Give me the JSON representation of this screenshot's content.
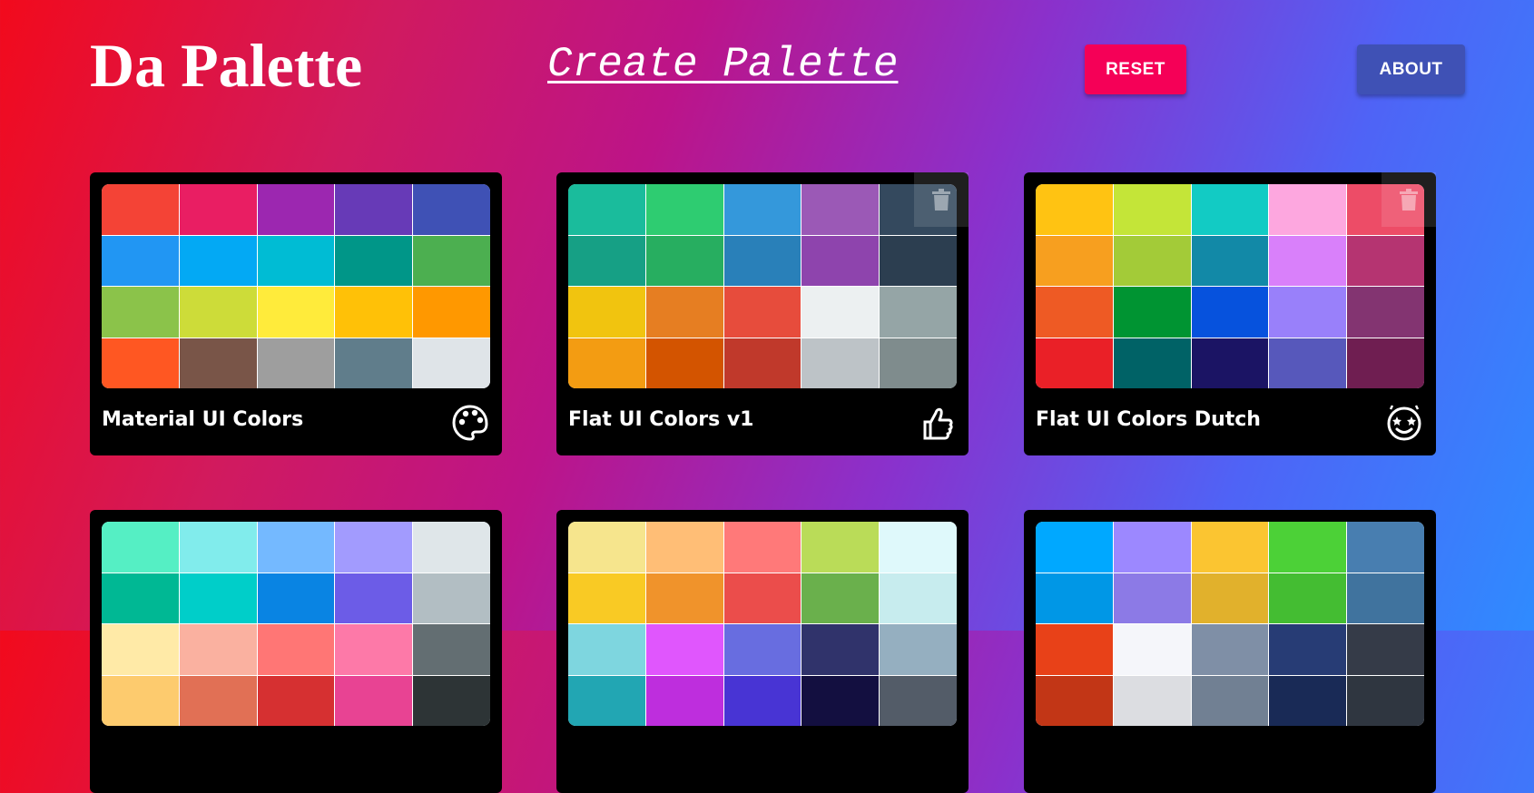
{
  "header": {
    "logo": "Da Palette",
    "create_link": "Create Palette",
    "reset_label": "RESET",
    "about_label": "ABOUT"
  },
  "palettes": [
    {
      "name": "Material UI Colors",
      "icon": "palette-icon",
      "deletable": false,
      "colors": [
        "#f44336",
        "#e91e63",
        "#9c27b0",
        "#673ab7",
        "#3f51b5",
        "#2196f3",
        "#03a9f4",
        "#00bcd4",
        "#009688",
        "#4caf50",
        "#8bc34a",
        "#cddc39",
        "#ffeb3b",
        "#ffc107",
        "#ff9800",
        "#ff5722",
        "#795548",
        "#9e9e9e",
        "#607d8b",
        "#dfe4e8"
      ]
    },
    {
      "name": "Flat UI Colors v1",
      "icon": "thumbs-up-icon",
      "deletable": true,
      "colors": [
        "#1abc9c",
        "#2ecc71",
        "#3498db",
        "#9b59b6",
        "#34495e",
        "#16a085",
        "#27ae60",
        "#2980b9",
        "#8e44ad",
        "#2c3e50",
        "#f1c40f",
        "#e67e22",
        "#e74c3c",
        "#ecf0f1",
        "#95a5a6",
        "#f39c12",
        "#d35400",
        "#c0392b",
        "#bdc3c7",
        "#7f8c8d"
      ]
    },
    {
      "name": "Flat UI Colors Dutch",
      "icon": "starstruck-face-icon",
      "deletable": true,
      "colors": [
        "#ffc312",
        "#c4e538",
        "#12cbc4",
        "#fda7df",
        "#ed4c67",
        "#f79f1f",
        "#a3cb38",
        "#1289a7",
        "#d980fa",
        "#b53471",
        "#ee5a24",
        "#009432",
        "#0652dd",
        "#9980fa",
        "#833471",
        "#ea2027",
        "#006266",
        "#1b1464",
        "#5758bb",
        "#6f1e51"
      ]
    },
    {
      "name": "",
      "icon": "",
      "deletable": false,
      "colors": [
        "#55efc4",
        "#81ecec",
        "#74b9ff",
        "#a29bfe",
        "#dfe6e9",
        "#00b894",
        "#00cec9",
        "#0984e3",
        "#6c5ce7",
        "#b2bec3",
        "#ffeaa7",
        "#fab1a0",
        "#ff7675",
        "#fd79a8",
        "#636e72",
        "#fdcb6e",
        "#e17055",
        "#d63031",
        "#e84393",
        "#2d3436"
      ]
    },
    {
      "name": "",
      "icon": "",
      "deletable": false,
      "colors": [
        "#f6e58d",
        "#ffbe76",
        "#ff7979",
        "#badc58",
        "#dff9fb",
        "#f9ca24",
        "#f0932b",
        "#eb4d4b",
        "#6ab04c",
        "#c7ecee",
        "#7ed6df",
        "#e056fd",
        "#686de0",
        "#30336b",
        "#95afc0",
        "#22a6b3",
        "#be2edd",
        "#4834d4",
        "#130f40",
        "#535c68"
      ]
    },
    {
      "name": "",
      "icon": "",
      "deletable": false,
      "colors": [
        "#00a8ff",
        "#9c88ff",
        "#fbc531",
        "#4cd137",
        "#487eb0",
        "#0097e6",
        "#8c7ae6",
        "#e1b12c",
        "#44bd32",
        "#40739e",
        "#e84118",
        "#f5f6fa",
        "#7f8fa6",
        "#273c75",
        "#353b48",
        "#c23616",
        "#dcdde1",
        "#718093",
        "#192a56",
        "#2f3640"
      ]
    }
  ]
}
